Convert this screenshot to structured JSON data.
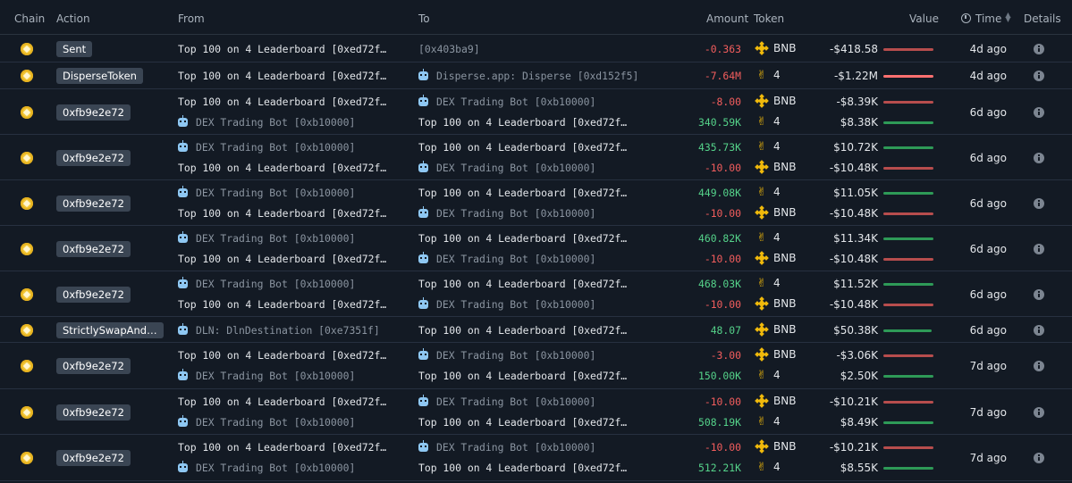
{
  "header": {
    "chain": "Chain",
    "action": "Action",
    "from": "From",
    "to": "To",
    "amount": "Amount",
    "token": "Token",
    "value": "Value",
    "time": "Time",
    "details": "Details"
  },
  "rows": [
    {
      "action": "Sent",
      "time": "4d ago",
      "lines": [
        {
          "from": "Top 100 on 4 Leaderboard [0xed72f…",
          "from_icon": false,
          "from_dim": false,
          "to": "[0x403ba9]",
          "to_icon": false,
          "to_dim": true,
          "amount": "-0.363",
          "sign": "neg",
          "token": "BNB",
          "value": "-$418.58",
          "bar": "red",
          "bar_level": 1.0
        }
      ]
    },
    {
      "action": "DisperseToken",
      "time": "4d ago",
      "lines": [
        {
          "from": "Top 100 on 4 Leaderboard [0xed72f…",
          "from_icon": false,
          "from_dim": false,
          "to": "Disperse.app: Disperse [0xd152f5]",
          "to_icon": true,
          "to_dim": true,
          "amount": "-7.64M",
          "sign": "neg",
          "token": "4",
          "value": "-$1.22M",
          "bar": "brightred",
          "bar_level": 1.0
        }
      ]
    },
    {
      "action": "0xfb9e2e72",
      "time": "6d ago",
      "lines": [
        {
          "from": "Top 100 on 4 Leaderboard [0xed72f…",
          "from_icon": false,
          "from_dim": false,
          "to": "DEX Trading Bot [0xb10000]",
          "to_icon": true,
          "to_dim": true,
          "amount": "-8.00",
          "sign": "neg",
          "token": "BNB",
          "value": "-$8.39K",
          "bar": "red",
          "bar_level": 1.0
        },
        {
          "from": "DEX Trading Bot [0xb10000]",
          "from_icon": true,
          "from_dim": true,
          "to": "Top 100 on 4 Leaderboard [0xed72f…",
          "to_icon": false,
          "to_dim": false,
          "amount": "340.59K",
          "sign": "pos",
          "token": "4",
          "value": "$8.38K",
          "bar": "green",
          "bar_level": 1.0
        }
      ]
    },
    {
      "action": "0xfb9e2e72",
      "time": "6d ago",
      "lines": [
        {
          "from": "DEX Trading Bot [0xb10000]",
          "from_icon": true,
          "from_dim": true,
          "to": "Top 100 on 4 Leaderboard [0xed72f…",
          "to_icon": false,
          "to_dim": false,
          "amount": "435.73K",
          "sign": "pos",
          "token": "4",
          "value": "$10.72K",
          "bar": "green",
          "bar_level": 1.0
        },
        {
          "from": "Top 100 on 4 Leaderboard [0xed72f…",
          "from_icon": false,
          "from_dim": false,
          "to": "DEX Trading Bot [0xb10000]",
          "to_icon": true,
          "to_dim": true,
          "amount": "-10.00",
          "sign": "neg",
          "token": "BNB",
          "value": "-$10.48K",
          "bar": "red",
          "bar_level": 1.0
        }
      ]
    },
    {
      "action": "0xfb9e2e72",
      "time": "6d ago",
      "lines": [
        {
          "from": "DEX Trading Bot [0xb10000]",
          "from_icon": true,
          "from_dim": true,
          "to": "Top 100 on 4 Leaderboard [0xed72f…",
          "to_icon": false,
          "to_dim": false,
          "amount": "449.08K",
          "sign": "pos",
          "token": "4",
          "value": "$11.05K",
          "bar": "green",
          "bar_level": 1.0
        },
        {
          "from": "Top 100 on 4 Leaderboard [0xed72f…",
          "from_icon": false,
          "from_dim": false,
          "to": "DEX Trading Bot [0xb10000]",
          "to_icon": true,
          "to_dim": true,
          "amount": "-10.00",
          "sign": "neg",
          "token": "BNB",
          "value": "-$10.48K",
          "bar": "red",
          "bar_level": 1.0
        }
      ]
    },
    {
      "action": "0xfb9e2e72",
      "time": "6d ago",
      "lines": [
        {
          "from": "DEX Trading Bot [0xb10000]",
          "from_icon": true,
          "from_dim": true,
          "to": "Top 100 on 4 Leaderboard [0xed72f…",
          "to_icon": false,
          "to_dim": false,
          "amount": "460.82K",
          "sign": "pos",
          "token": "4",
          "value": "$11.34K",
          "bar": "green",
          "bar_level": 1.0
        },
        {
          "from": "Top 100 on 4 Leaderboard [0xed72f…",
          "from_icon": false,
          "from_dim": false,
          "to": "DEX Trading Bot [0xb10000]",
          "to_icon": true,
          "to_dim": true,
          "amount": "-10.00",
          "sign": "neg",
          "token": "BNB",
          "value": "-$10.48K",
          "bar": "red",
          "bar_level": 1.0
        }
      ]
    },
    {
      "action": "0xfb9e2e72",
      "time": "6d ago",
      "lines": [
        {
          "from": "DEX Trading Bot [0xb10000]",
          "from_icon": true,
          "from_dim": true,
          "to": "Top 100 on 4 Leaderboard [0xed72f…",
          "to_icon": false,
          "to_dim": false,
          "amount": "468.03K",
          "sign": "pos",
          "token": "4",
          "value": "$11.52K",
          "bar": "green",
          "bar_level": 1.0
        },
        {
          "from": "Top 100 on 4 Leaderboard [0xed72f…",
          "from_icon": false,
          "from_dim": false,
          "to": "DEX Trading Bot [0xb10000]",
          "to_icon": true,
          "to_dim": true,
          "amount": "-10.00",
          "sign": "neg",
          "token": "BNB",
          "value": "-$10.48K",
          "bar": "red",
          "bar_level": 1.0
        }
      ]
    },
    {
      "action": "StrictlySwapAnd…",
      "time": "6d ago",
      "lines": [
        {
          "from": "DLN: DlnDestination [0xe7351f]",
          "from_icon": true,
          "from_dim": true,
          "to": "Top 100 on 4 Leaderboard [0xed72f…",
          "to_icon": false,
          "to_dim": false,
          "amount": "48.07",
          "sign": "pos",
          "token": "BNB",
          "value": "$50.38K",
          "bar": "green",
          "bar_level": 0.96
        }
      ]
    },
    {
      "action": "0xfb9e2e72",
      "time": "7d ago",
      "lines": [
        {
          "from": "Top 100 on 4 Leaderboard [0xed72f…",
          "from_icon": false,
          "from_dim": false,
          "to": "DEX Trading Bot [0xb10000]",
          "to_icon": true,
          "to_dim": true,
          "amount": "-3.00",
          "sign": "neg",
          "token": "BNB",
          "value": "-$3.06K",
          "bar": "red",
          "bar_level": 1.0
        },
        {
          "from": "DEX Trading Bot [0xb10000]",
          "from_icon": true,
          "from_dim": true,
          "to": "Top 100 on 4 Leaderboard [0xed72f…",
          "to_icon": false,
          "to_dim": false,
          "amount": "150.00K",
          "sign": "pos",
          "token": "4",
          "value": "$2.50K",
          "bar": "green",
          "bar_level": 1.0
        }
      ]
    },
    {
      "action": "0xfb9e2e72",
      "time": "7d ago",
      "lines": [
        {
          "from": "Top 100 on 4 Leaderboard [0xed72f…",
          "from_icon": false,
          "from_dim": false,
          "to": "DEX Trading Bot [0xb10000]",
          "to_icon": true,
          "to_dim": true,
          "amount": "-10.00",
          "sign": "neg",
          "token": "BNB",
          "value": "-$10.21K",
          "bar": "red",
          "bar_level": 1.0
        },
        {
          "from": "DEX Trading Bot [0xb10000]",
          "from_icon": true,
          "from_dim": true,
          "to": "Top 100 on 4 Leaderboard [0xed72f…",
          "to_icon": false,
          "to_dim": false,
          "amount": "508.19K",
          "sign": "pos",
          "token": "4",
          "value": "$8.49K",
          "bar": "green",
          "bar_level": 1.0
        }
      ]
    },
    {
      "action": "0xfb9e2e72",
      "time": "7d ago",
      "lines": [
        {
          "from": "Top 100 on 4 Leaderboard [0xed72f…",
          "from_icon": false,
          "from_dim": false,
          "to": "DEX Trading Bot [0xb10000]",
          "to_icon": true,
          "to_dim": true,
          "amount": "-10.00",
          "sign": "neg",
          "token": "BNB",
          "value": "-$10.21K",
          "bar": "red",
          "bar_level": 1.0
        },
        {
          "from": "DEX Trading Bot [0xb10000]",
          "from_icon": true,
          "from_dim": true,
          "to": "Top 100 on 4 Leaderboard [0xed72f…",
          "to_icon": false,
          "to_dim": false,
          "amount": "512.21K",
          "sign": "pos",
          "token": "4",
          "value": "$8.55K",
          "bar": "green",
          "bar_level": 1.0
        }
      ]
    }
  ],
  "colors": {
    "background": "#131a24",
    "negative": "#f35d5d",
    "positive": "#55d38a",
    "bnb": "#f0b90b",
    "chain_icon": "#f3c83a"
  },
  "icons": {
    "chain": "bnb-chain-icon",
    "bot": "robot-icon",
    "bnb_token": "bnb-token-icon",
    "four_token": "hand-token-icon",
    "details": "info-icon",
    "time": "clock-icon"
  }
}
